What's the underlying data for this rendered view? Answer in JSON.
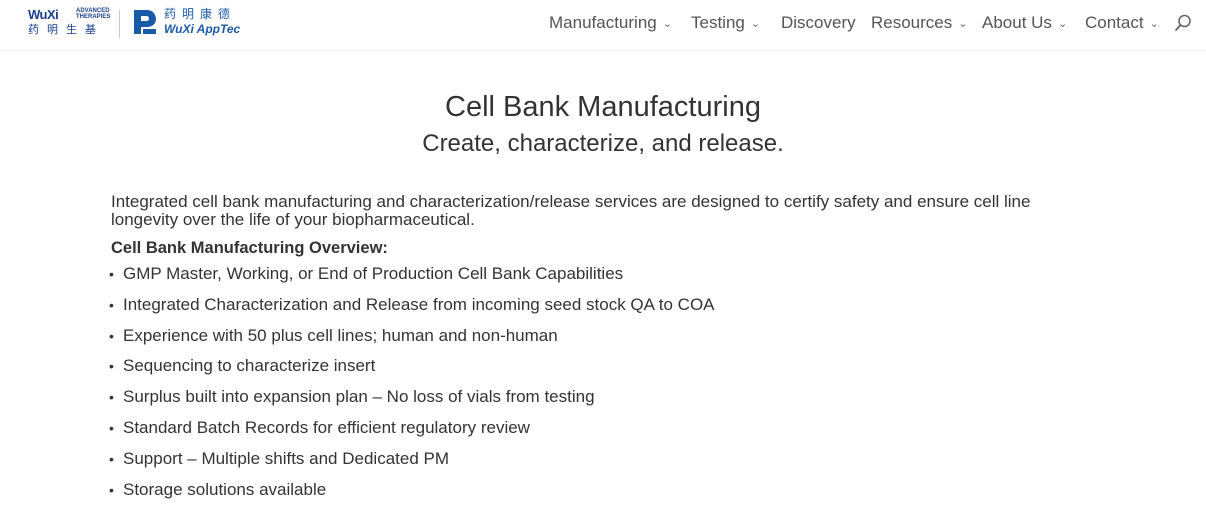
{
  "header": {
    "logo_advanced": {
      "name": "WuXi",
      "tag_line1": "ADVANCED",
      "tag_line2": "THERAPIES",
      "chinese": "药明生基"
    },
    "logo_apptec": {
      "chinese": "药明康德",
      "name": "WuXi AppTec"
    },
    "nav": [
      {
        "label": "Manufacturing",
        "has_dropdown": true
      },
      {
        "label": "Testing",
        "has_dropdown": true
      },
      {
        "label": "Discovery",
        "has_dropdown": false
      },
      {
        "label": "Resources",
        "has_dropdown": true
      },
      {
        "label": "About Us",
        "has_dropdown": true
      },
      {
        "label": "Contact",
        "has_dropdown": true
      }
    ],
    "search_icon": "search-icon"
  },
  "main": {
    "title": "Cell Bank Manufacturing",
    "subtitle": "Create, characterize, and release.",
    "intro": "Integrated cell bank manufacturing and characterization/release services are designed to certify safety and ensure cell line longevity over the life of your biopharmaceutical.",
    "overview_heading": "Cell Bank Manufacturing Overview:",
    "capabilities": [
      "GMP Master, Working, or End of Production Cell Bank Capabilities",
      "Integrated Characterization and Release from incoming seed stock QA to COA",
      "Experience with 50 plus cell lines; human and non-human",
      "Sequencing to characterize insert",
      "Surplus built into expansion plan – No loss of vials from testing",
      "Standard Batch Records for efficient regulatory review",
      "Support – Multiple shifts and Dedicated PM",
      "Storage solutions available"
    ]
  },
  "colors": {
    "brand_blue": "#1a3f8f",
    "brand_blue_light": "#1a5ba8",
    "text": "#333333",
    "nav_text": "#555555"
  }
}
